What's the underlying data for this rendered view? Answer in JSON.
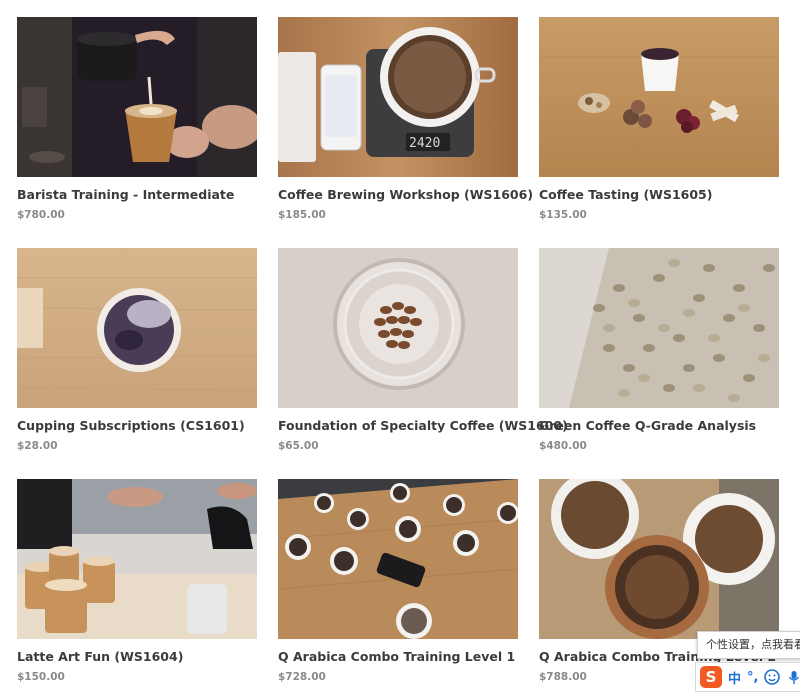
{
  "products": [
    {
      "title": "Barista Training - Intermediate",
      "price": "$780.00",
      "image": "latte-pour-photo"
    },
    {
      "title": "Coffee Brewing Workshop (WS1606)",
      "price": "$185.00",
      "image": "scale-brew-photo"
    },
    {
      "title": "Coffee Tasting (WS1605)",
      "price": "$135.00",
      "image": "tasting-cup-photo"
    },
    {
      "title": "Cupping Subscriptions (CS1601)",
      "price": "$28.00",
      "image": "cupping-cup-photo"
    },
    {
      "title": "Foundation of Specialty Coffee (WS1600)",
      "price": "$65.00",
      "image": "beans-in-glass-photo"
    },
    {
      "title": "Green Coffee Q-Grade Analysis",
      "price": "$480.00",
      "image": "green-beans-photo"
    },
    {
      "title": "Latte Art Fun (WS1604)",
      "price": "$150.00",
      "image": "latte-art-photo"
    },
    {
      "title": "Q Arabica Combo Training Level 1",
      "price": "$728.00",
      "image": "cupping-table-photo"
    },
    {
      "title": "Q Arabica Combo Training Level 2",
      "price": "$788.00",
      "image": "ground-coffee-bowls-photo"
    }
  ],
  "scale_display": "2420",
  "ime": {
    "tooltip": "个性设置，点我看看",
    "logo": "S",
    "mode": "中",
    "punct": "°,",
    "colors": {
      "logo": "#f25a22",
      "accent": "#1d6fd6"
    },
    "icons": [
      "emoji-icon",
      "microphone-icon"
    ]
  }
}
